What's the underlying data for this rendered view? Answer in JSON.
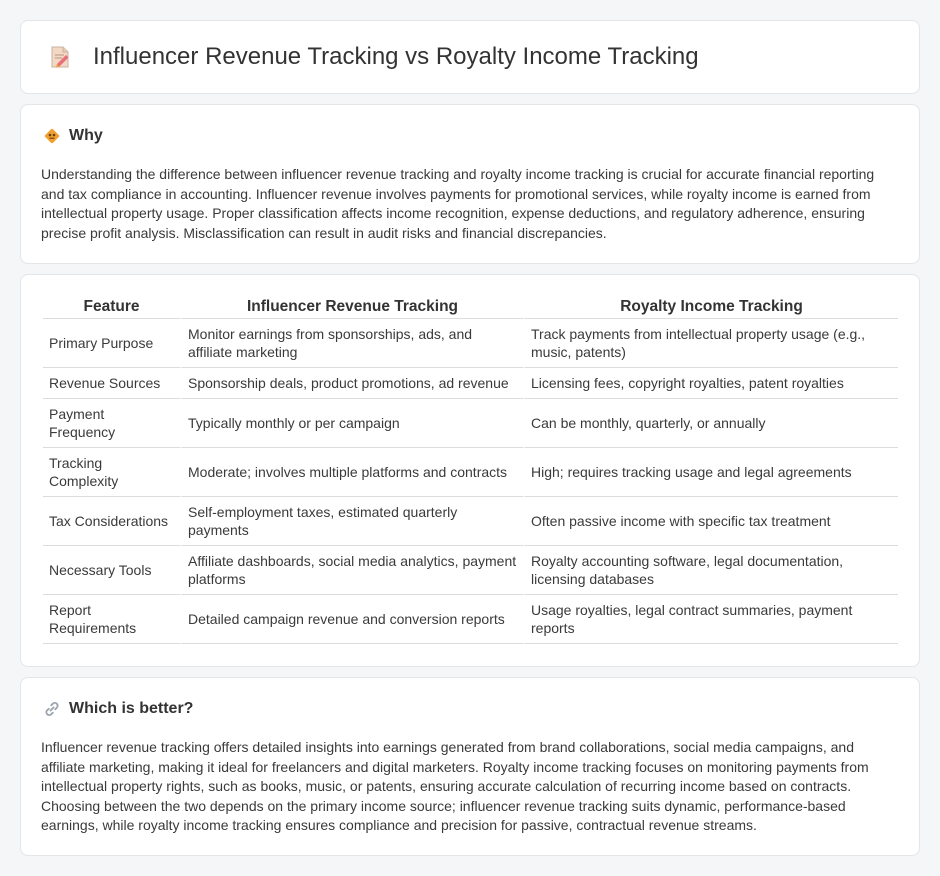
{
  "header": {
    "title": "Influencer Revenue Tracking vs Royalty Income Tracking",
    "icon": "document-edit-icon"
  },
  "why": {
    "title": "Why",
    "icon": "diamond-sign-icon",
    "text": "Understanding the difference between influencer revenue tracking and royalty income tracking is crucial for accurate financial reporting and tax compliance in accounting. Influencer revenue involves payments for promotional services, while royalty income is earned from intellectual property usage. Proper classification affects income recognition, expense deductions, and regulatory adherence, ensuring precise profit analysis. Misclassification can result in audit risks and financial discrepancies."
  },
  "table": {
    "headers": [
      "Feature",
      "Influencer Revenue Tracking",
      "Royalty Income Tracking"
    ],
    "rows": [
      [
        "Primary Purpose",
        "Monitor earnings from sponsorships, ads, and affiliate marketing",
        "Track payments from intellectual property usage (e.g., music, patents)"
      ],
      [
        "Revenue Sources",
        "Sponsorship deals, product promotions, ad revenue",
        "Licensing fees, copyright royalties, patent royalties"
      ],
      [
        "Payment Frequency",
        "Typically monthly or per campaign",
        "Can be monthly, quarterly, or annually"
      ],
      [
        "Tracking Complexity",
        "Moderate; involves multiple platforms and contracts",
        "High; requires tracking usage and legal agreements"
      ],
      [
        "Tax Considerations",
        "Self-employment taxes, estimated quarterly payments",
        "Often passive income with specific tax treatment"
      ],
      [
        "Necessary Tools",
        "Affiliate dashboards, social media analytics, payment platforms",
        "Royalty accounting software, legal documentation, licensing databases"
      ],
      [
        "Report Requirements",
        "Detailed campaign revenue and conversion reports",
        "Usage royalties, legal contract summaries, payment reports"
      ]
    ]
  },
  "better": {
    "title": "Which is better?",
    "icon": "link-icon",
    "text": "Influencer revenue tracking offers detailed insights into earnings generated from brand collaborations, social media campaigns, and affiliate marketing, making it ideal for freelancers and digital marketers. Royalty income tracking focuses on monitoring payments from intellectual property rights, such as books, music, or patents, ensuring accurate calculation of recurring income based on contracts. Choosing between the two depends on the primary income source; influencer revenue tracking suits dynamic, performance-based earnings, while royalty income tracking ensures compliance and precision for passive, contractual revenue streams."
  },
  "colors": {
    "page_background": "#f5f6f8",
    "card_background": "#ffffff",
    "border": "#e3e5e8",
    "icon_orange": "#f0a030",
    "icon_pink": "#e8707a"
  }
}
